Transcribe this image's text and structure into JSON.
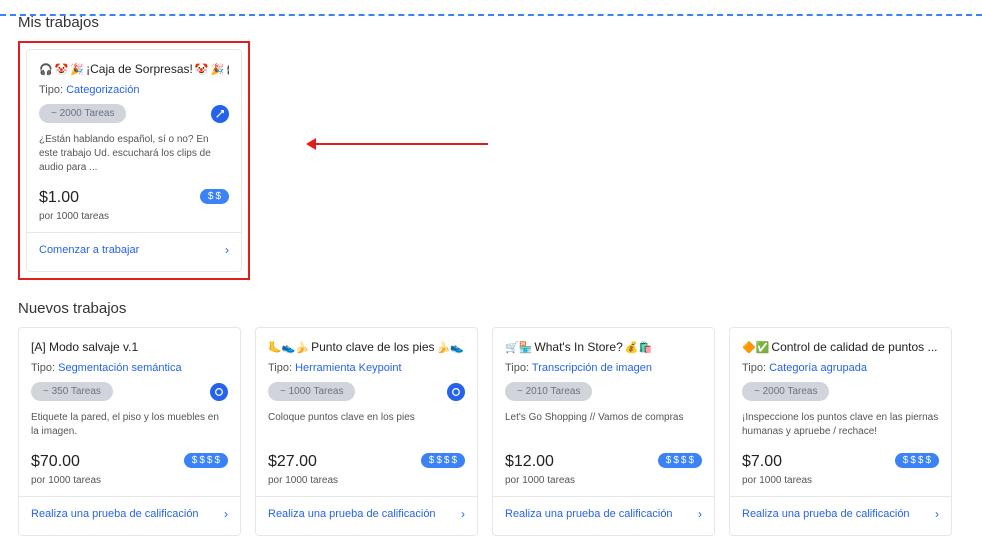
{
  "sections": {
    "my_jobs": "Mis trabajos",
    "new_jobs": "Nuevos trabajos"
  },
  "labels": {
    "type": "Tipo:",
    "per_1000": "por 1000 tareas",
    "start_work": "Comenzar a trabajar",
    "qualify_test": "Realiza una prueba de calificación"
  },
  "featured": {
    "title": "¡Caja de Sorpresas!",
    "type_link": "Categorización",
    "pill": "~ 2000 Tareas",
    "desc": "¿Están hablando español, sí o no? En este trabajo Ud. escuchará los clips de audio para ...",
    "price": "$1.00",
    "badge_count": 2
  },
  "new_cards": [
    {
      "title": "[A] Modo salvaje v.1",
      "type_link": "Segmentación semántica",
      "pill": "~ 350 Tareas",
      "desc": "Etiquete la pared, el piso y los muebles en la imagen.",
      "price": "$70.00",
      "badge_count": 4,
      "show_circle": true,
      "prefix_emojis": "",
      "suffix_emojis": ""
    },
    {
      "title": "Punto clave de los pies",
      "type_link": "Herramienta Keypoint",
      "pill": "~ 1000 Tareas",
      "desc": "Coloque puntos clave en los pies",
      "price": "$27.00",
      "badge_count": 4,
      "show_circle": true,
      "prefix_emojis": "🦶👟🍌",
      "suffix_emojis": "🍌👟"
    },
    {
      "title": "What's In Store?",
      "type_link": "Transcripción de imagen",
      "pill": "~ 2010 Tareas",
      "desc": "Let's Go Shopping // Vamos de compras",
      "price": "$12.00",
      "badge_count": 4,
      "show_circle": false,
      "prefix_emojis": "🛒🏪",
      "suffix_emojis": "💰🛍️"
    },
    {
      "title": "Control de calidad de puntos ...",
      "type_link": "Categoría agrupada",
      "pill": "~ 2000 Tareas",
      "desc": "¡Inspeccione los puntos clave en las piernas humanas y apruebe / rechace!",
      "price": "$7.00",
      "badge_count": 4,
      "show_circle": false,
      "prefix_emojis": "🔶✅",
      "suffix_emojis": ""
    }
  ]
}
